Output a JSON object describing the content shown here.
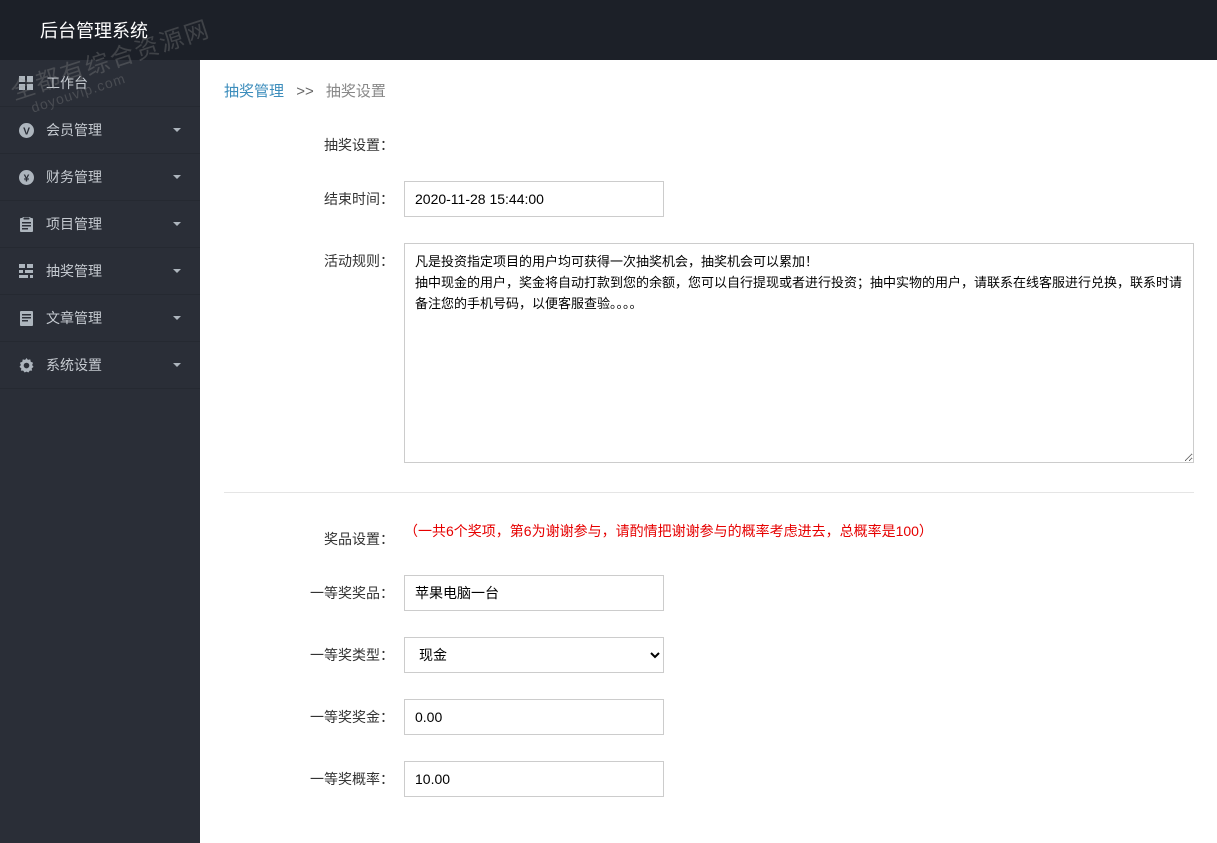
{
  "header": {
    "title": "后台管理系统"
  },
  "sidebar": {
    "items": [
      {
        "icon": "grid",
        "label": "工作台",
        "chevron": false
      },
      {
        "icon": "circle-v",
        "label": "会员管理",
        "chevron": true
      },
      {
        "icon": "circle-yen",
        "label": "财务管理",
        "chevron": true
      },
      {
        "icon": "clipboard",
        "label": "项目管理",
        "chevron": true
      },
      {
        "icon": "grid4",
        "label": "抽奖管理",
        "chevron": true
      },
      {
        "icon": "doc",
        "label": "文章管理",
        "chevron": true
      },
      {
        "icon": "gear",
        "label": "系统设置",
        "chevron": true
      }
    ]
  },
  "breadcrumb": {
    "link": "抽奖管理",
    "sep": ">>",
    "current": "抽奖设置"
  },
  "form": {
    "section_label": "抽奖设置：",
    "end_time_label": "结束时间：",
    "end_time_value": "2020-11-28 15:44:00",
    "rules_label": "活动规则：",
    "rules_value": "凡是投资指定项目的用户均可获得一次抽奖机会，抽奖机会可以累加！\n抽中现金的用户，奖金将自动打款到您的余额，您可以自行提现或者进行投资；抽中实物的用户，请联系在线客服进行兑换，联系时请备注您的手机号码，以便客服查验。。。。",
    "prize_section_label": "奖品设置：",
    "prize_hint": "（一共6个奖项，第6为谢谢参与，请酌情把谢谢参与的概率考虑进去，总概率是100）",
    "prize1_name_label": "一等奖奖品：",
    "prize1_name_value": "苹果电脑一台",
    "prize1_type_label": "一等奖类型：",
    "prize1_type_value": "现金",
    "prize1_amount_label": "一等奖奖金：",
    "prize1_amount_value": "0.00",
    "prize1_prob_label": "一等奖概率：",
    "prize1_prob_value": "10.00"
  },
  "watermark": {
    "line1": "全都有综合资源网",
    "line2": "doyouvip.com"
  }
}
